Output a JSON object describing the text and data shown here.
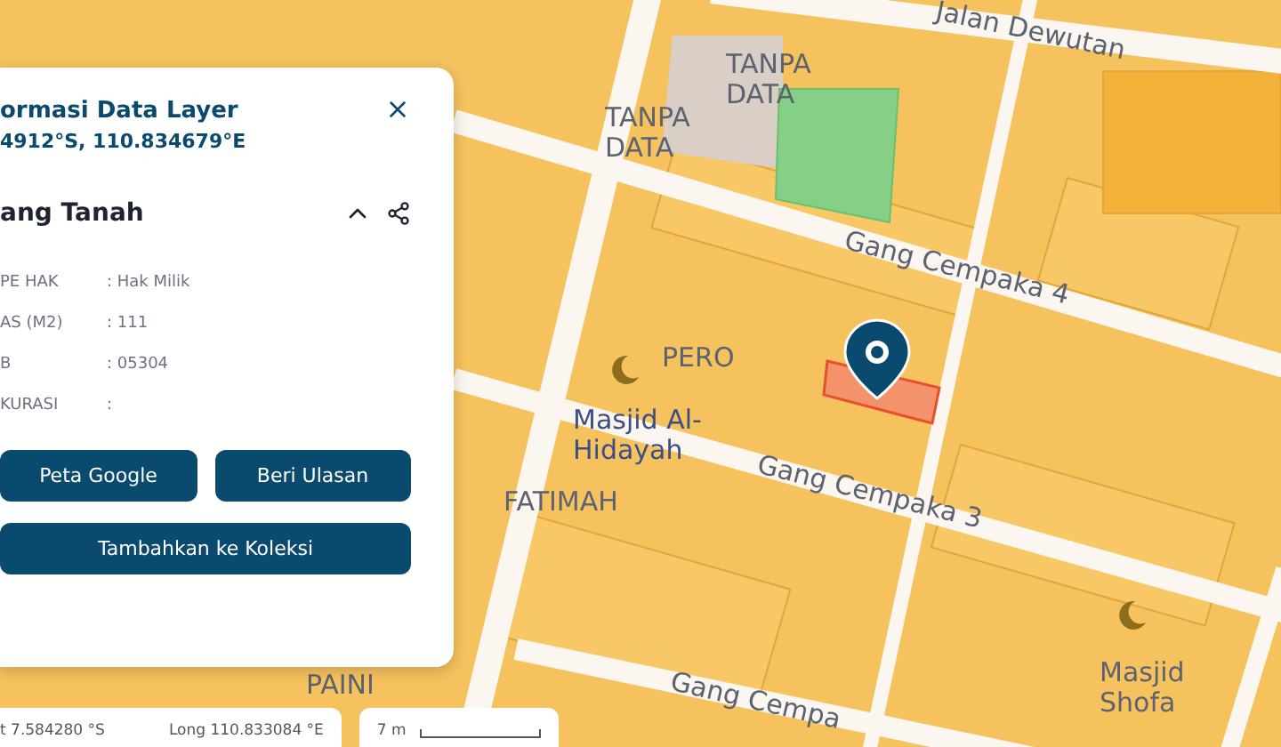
{
  "map": {
    "labels": [
      {
        "text": "Jalan Dewutan",
        "kind": "road"
      },
      {
        "text": "TANPA DATA",
        "kind": "area"
      },
      {
        "text": "TANPA DATA",
        "kind": "area"
      },
      {
        "text": "Gang Cempaka 4",
        "kind": "road"
      },
      {
        "text": "PERO",
        "kind": "area"
      },
      {
        "text": "Masjid Al-Hidayah",
        "kind": "poi"
      },
      {
        "text": "FATIMAH",
        "kind": "area"
      },
      {
        "text": "Gang Cempaka 3",
        "kind": "road"
      },
      {
        "text": "Masjid Shofa",
        "kind": "area"
      },
      {
        "text": "Gang Cempa",
        "kind": "road"
      },
      {
        "text": "PAINI",
        "kind": "area"
      }
    ]
  },
  "panel": {
    "title": "ormasi Data Layer",
    "coordinates": "4912°S, 110.834679°E",
    "section": {
      "title": "ang Tanah",
      "expanded": true
    },
    "rows": [
      {
        "label": "PE HAK",
        "value": ": Hak Milik"
      },
      {
        "label": "AS (M2)",
        "value": ": 111"
      },
      {
        "label": "B",
        "value": ": 05304"
      },
      {
        "label": "KURASI",
        "value": ":"
      }
    ],
    "buttons": [
      "Peta Google",
      "Beri Ulasan"
    ],
    "wide_button": "Tambahkan ke Koleksi"
  },
  "status_bar": {
    "lat": "t 7.584280 °S",
    "long": "Long 110.833084 °E",
    "scale": "7 m"
  }
}
